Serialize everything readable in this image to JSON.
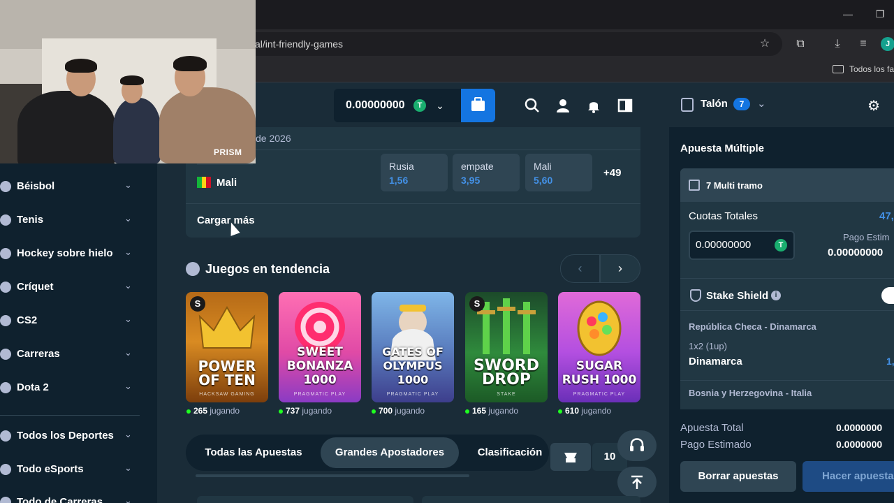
{
  "browser": {
    "url": "al/int-friendly-games",
    "bookmark": "Todos los fa",
    "avatar_letter": "J"
  },
  "webcam": {
    "watermark": "PRISM"
  },
  "header": {
    "balance": "0.00000000",
    "coin_symbol": "T"
  },
  "sidebar": {
    "items": [
      {
        "label": "Béisbol"
      },
      {
        "label": "Tenis"
      },
      {
        "label": "Hockey sobre hielo"
      },
      {
        "label": "Críquet"
      },
      {
        "label": "CS2"
      },
      {
        "label": "Carreras"
      },
      {
        "label": "Dota 2"
      },
      {
        "label": "Todos los Deportes"
      },
      {
        "label": "Todo eSports"
      },
      {
        "label": "Todo de Carreras"
      }
    ]
  },
  "match": {
    "date_fragment": "de 2026",
    "team": "Mali",
    "odds": [
      {
        "label": "Rusia",
        "value": "1,56"
      },
      {
        "label": "empate",
        "value": "3,95"
      },
      {
        "label": "Mali",
        "value": "5,60"
      }
    ],
    "more_markets": "+49",
    "load_more": "Cargar más"
  },
  "trending": {
    "title": "Juegos en tendencia",
    "games": [
      {
        "title_l1": "POWER",
        "title_l2": "OF TEN",
        "sub": "HACKSAW GAMING",
        "players": "265",
        "suffix": "jugando"
      },
      {
        "title_l1": "SWEET",
        "title_l2": "BONANZA 1000",
        "sub": "PRAGMATIC PLAY",
        "players": "737",
        "suffix": "jugando"
      },
      {
        "title_l1": "GATES OF",
        "title_l2": "OLYMPUS 1000",
        "sub": "PRAGMATIC PLAY",
        "players": "700",
        "suffix": "jugando"
      },
      {
        "title_l1": "SWORD",
        "title_l2": "DROP",
        "sub": "STAKE",
        "players": "165",
        "suffix": "jugando"
      },
      {
        "title_l1": "SUGAR",
        "title_l2": "RUSH 1000",
        "sub": "PRAGMATIC PLAY",
        "players": "610",
        "suffix": "jugando"
      }
    ]
  },
  "tabs": {
    "items": [
      "Todas las Apuestas",
      "Grandes Apostadores",
      "Clasificación"
    ],
    "page_size": "10"
  },
  "betslip": {
    "title": "Talón",
    "count": "7",
    "type": "Apuesta Múltiple",
    "multi_label": "7 Multi tramo",
    "total_odds_label": "Cuotas Totales",
    "total_odds_value": "47,",
    "stake_value": "0.00000000",
    "payout_label": "Pago Estim",
    "payout_value": "0.00000000",
    "shield_label": "Stake Shield",
    "selections": [
      {
        "event": "República Checa - Dinamarca",
        "market": "1x2 (1up)",
        "pick": "Dinamarca",
        "odd": "1,"
      },
      {
        "event": "Bosnia y Herzegovina - Italia"
      }
    ],
    "total_bet_label": "Apuesta Total",
    "total_bet_value": "0.0000000",
    "est_payout_label": "Pago Estimado",
    "est_payout_value": "0.0000000",
    "clear_label": "Borrar apuestas",
    "place_label": "Hacer apuesta"
  },
  "colors": {
    "bg": "#0f212e",
    "panel": "#1a2c38",
    "card": "#213743",
    "accent_blue": "#1475e1",
    "odds_blue": "#4391e7",
    "live_green": "#1fff20"
  }
}
